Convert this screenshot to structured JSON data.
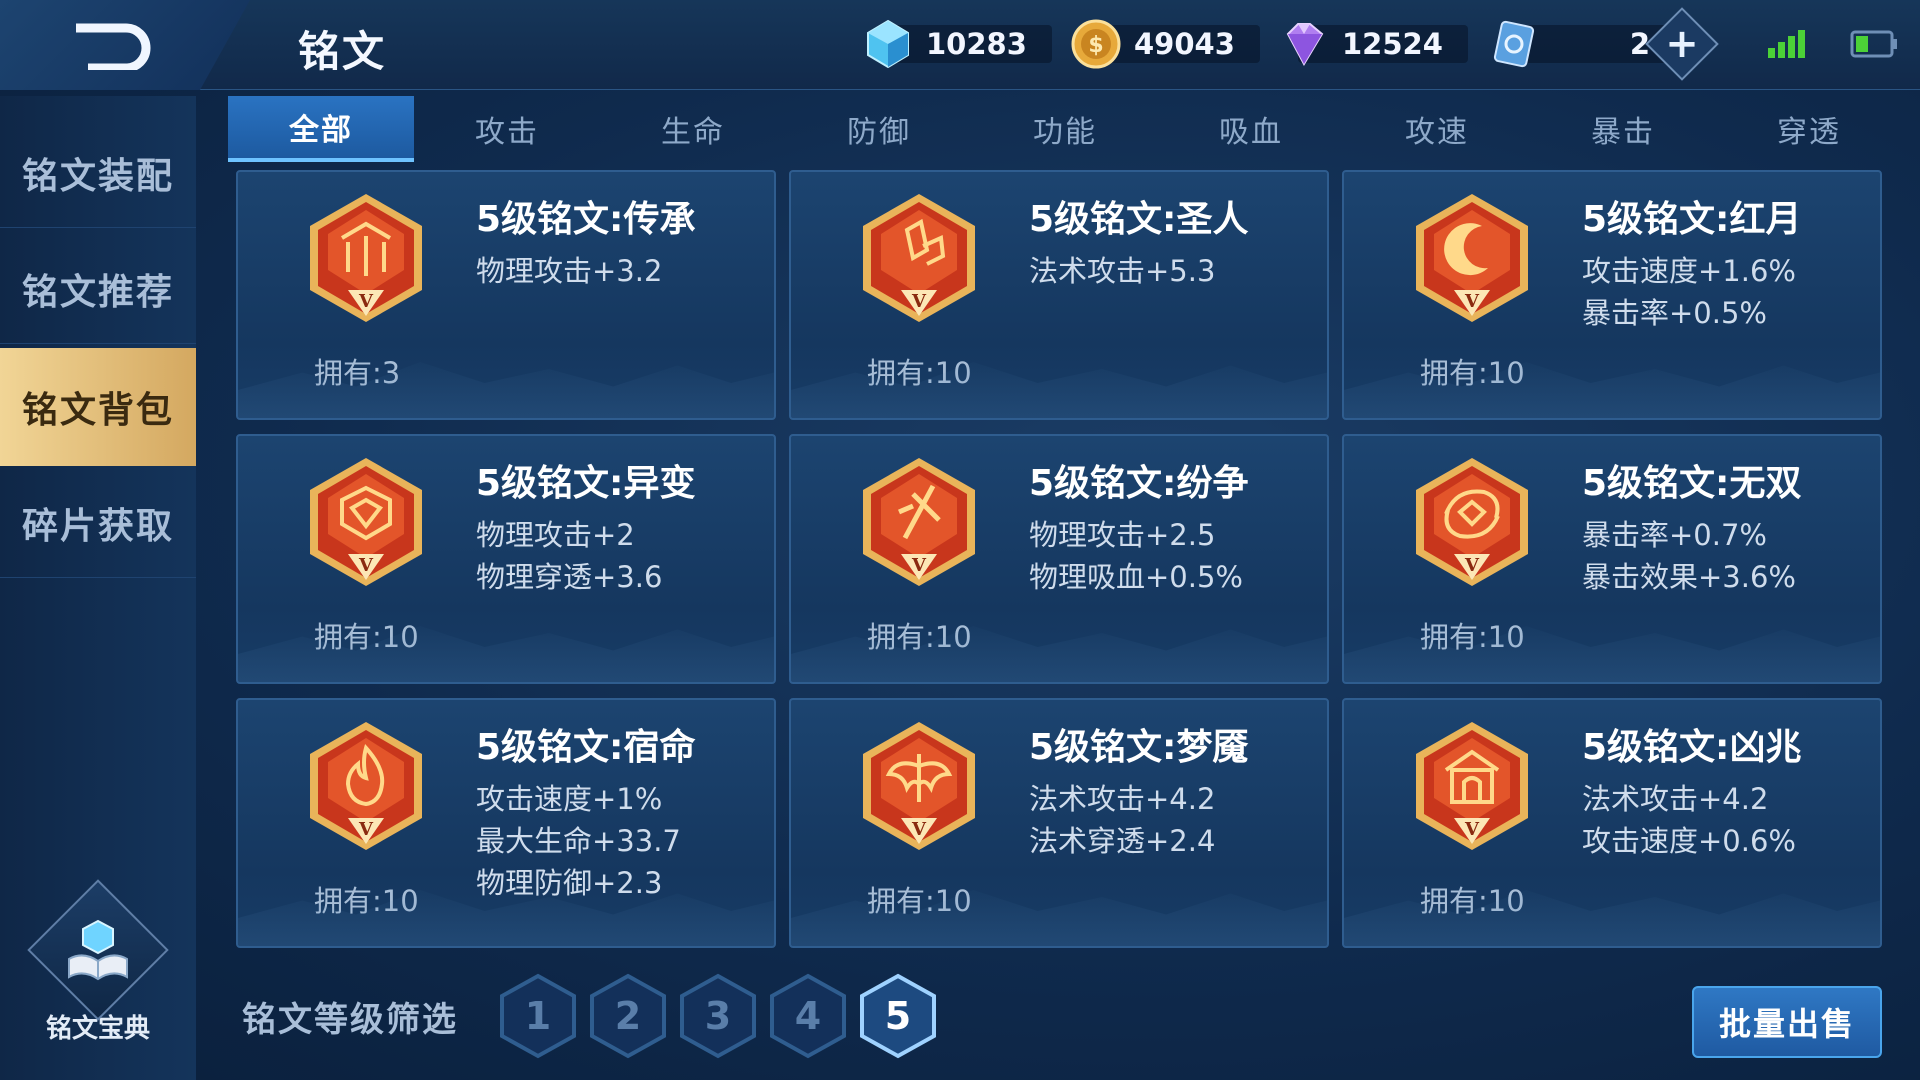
{
  "header": {
    "title": "铭文",
    "currencies": [
      {
        "name": "diamond-crystal",
        "value": "10283"
      },
      {
        "name": "gold-coin",
        "value": "49043"
      },
      {
        "name": "purple-gem",
        "value": "12524"
      },
      {
        "name": "card-ticket",
        "value": "2"
      }
    ]
  },
  "sidebar": {
    "items": [
      {
        "label": "铭文装配"
      },
      {
        "label": "铭文推荐"
      },
      {
        "label": "铭文背包"
      },
      {
        "label": "碎片获取"
      }
    ],
    "active_index": 2,
    "codex_label": "铭文宝典"
  },
  "tabs": [
    {
      "label": "全部"
    },
    {
      "label": "攻击"
    },
    {
      "label": "生命"
    },
    {
      "label": "防御"
    },
    {
      "label": "功能"
    },
    {
      "label": "吸血"
    },
    {
      "label": "攻速"
    },
    {
      "label": "暴击"
    },
    {
      "label": "穿透"
    }
  ],
  "active_tab": 0,
  "inscriptions": [
    {
      "title": "5级铭文:传承",
      "stats": [
        "物理攻击+3.2"
      ],
      "owned": "拥有:3",
      "emblem": "pillar-emblem-icon"
    },
    {
      "title": "5级铭文:圣人",
      "stats": [
        "法术攻击+5.3"
      ],
      "owned": "拥有:10",
      "emblem": "crystal-emblem-icon"
    },
    {
      "title": "5级铭文:红月",
      "stats": [
        "攻击速度+1.6%",
        "暴击率+0.5%"
      ],
      "owned": "拥有:10",
      "emblem": "crescent-moon-emblem-icon"
    },
    {
      "title": "5级铭文:异变",
      "stats": [
        "物理攻击+2",
        "物理穿透+3.6"
      ],
      "owned": "拥有:10",
      "emblem": "mask-emblem-icon"
    },
    {
      "title": "5级铭文:纷争",
      "stats": [
        "物理攻击+2.5",
        "物理吸血+0.5%"
      ],
      "owned": "拥有:10",
      "emblem": "blade-emblem-icon"
    },
    {
      "title": "5级铭文:无双",
      "stats": [
        "暴击率+0.7%",
        "暴击效果+3.6%"
      ],
      "owned": "拥有:10",
      "emblem": "swirl-emblem-icon"
    },
    {
      "title": "5级铭文:宿命",
      "stats": [
        "攻击速度+1%",
        "最大生命+33.7",
        "物理防御+2.3"
      ],
      "owned": "拥有:10",
      "emblem": "flame-emblem-icon"
    },
    {
      "title": "5级铭文:梦魇",
      "stats": [
        "法术攻击+4.2",
        "法术穿透+2.4"
      ],
      "owned": "拥有:10",
      "emblem": "wing-emblem-icon"
    },
    {
      "title": "5级铭文:凶兆",
      "stats": [
        "法术攻击+4.2",
        "攻击速度+0.6%"
      ],
      "owned": "拥有:10",
      "emblem": "gate-emblem-icon"
    }
  ],
  "emblem_level_mark": "V",
  "filter": {
    "label": "铭文等级筛选",
    "levels": [
      "1",
      "2",
      "3",
      "4",
      "5"
    ],
    "active_level": "5"
  },
  "batch_sell_label": "批量出售",
  "colors": {
    "accent_blue": "#2a73c2",
    "active_gold": "#e6c07a",
    "emblem_red": "#c8361c",
    "emblem_gold": "#e9b45a"
  }
}
